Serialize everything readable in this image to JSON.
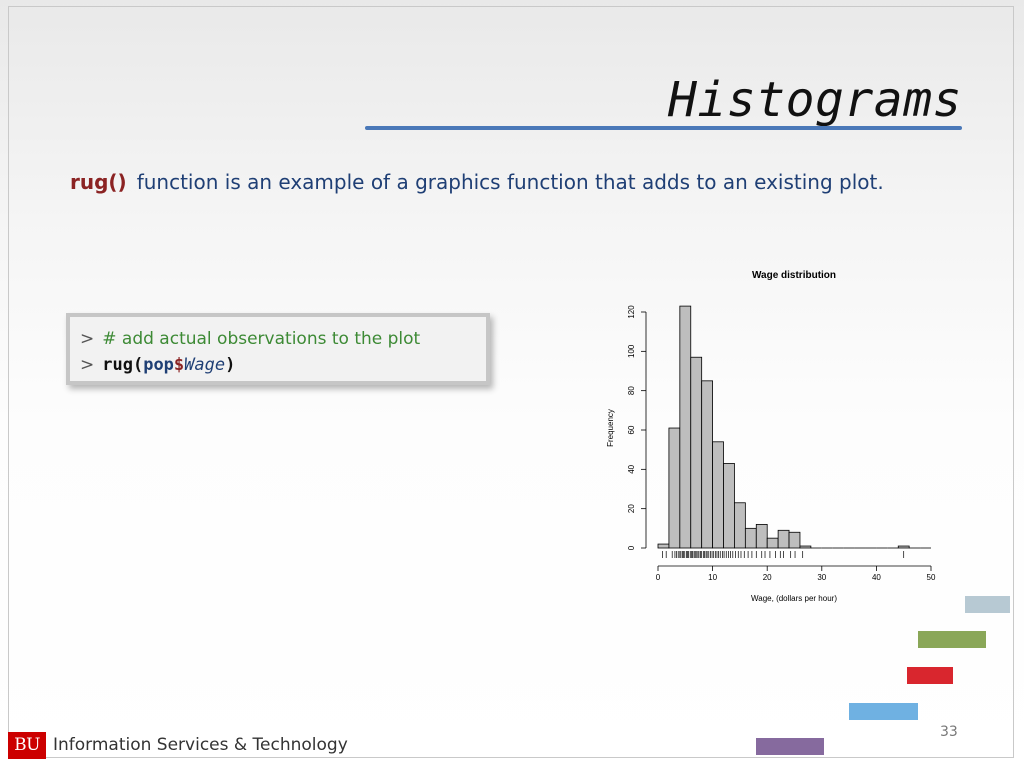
{
  "slide": {
    "title": "Histograms",
    "intro_fn": "rug()",
    "intro_text": "function is an example  of a graphics function that adds to an existing plot.",
    "code": {
      "line1_prompt": ">",
      "line1_comment": "# add actual observations to the plot",
      "line2_prompt": ">",
      "line2_fn": "rug(",
      "line2_obj": "pop",
      "line2_dollar": "$",
      "line2_var": "Wage",
      "line2_close": ")"
    },
    "page_number": "33"
  },
  "footer": {
    "logo_text": "BU",
    "org_name": "Information Services & Technology"
  },
  "colors": {
    "title_rule": "#4a78b8",
    "bar_fill": "#bebebe",
    "deco_bars": [
      "#b7c9d3",
      "#8aa758",
      "#d9262e",
      "#6fb1e2",
      "#866a9e"
    ]
  },
  "chart_data": {
    "type": "bar",
    "title": "Wage distribution",
    "xlabel": "Wage, (dollars per hour)",
    "ylabel": "Frequency",
    "xlim": [
      0,
      50
    ],
    "ylim": [
      0,
      120
    ],
    "xticks": [
      0,
      10,
      20,
      30,
      40,
      50
    ],
    "yticks": [
      0,
      20,
      40,
      60,
      80,
      100,
      120
    ],
    "bin_width": 2,
    "bins": [
      {
        "x0": 0,
        "x1": 2,
        "count": 2
      },
      {
        "x0": 2,
        "x1": 4,
        "count": 61
      },
      {
        "x0": 4,
        "x1": 6,
        "count": 123
      },
      {
        "x0": 6,
        "x1": 8,
        "count": 97
      },
      {
        "x0": 8,
        "x1": 10,
        "count": 85
      },
      {
        "x0": 10,
        "x1": 12,
        "count": 54
      },
      {
        "x0": 12,
        "x1": 14,
        "count": 43
      },
      {
        "x0": 14,
        "x1": 16,
        "count": 23
      },
      {
        "x0": 16,
        "x1": 18,
        "count": 10
      },
      {
        "x0": 18,
        "x1": 20,
        "count": 12
      },
      {
        "x0": 20,
        "x1": 22,
        "count": 5
      },
      {
        "x0": 22,
        "x1": 24,
        "count": 9
      },
      {
        "x0": 24,
        "x1": 26,
        "count": 8
      },
      {
        "x0": 26,
        "x1": 28,
        "count": 1
      },
      {
        "x0": 28,
        "x1": 30,
        "count": 0
      },
      {
        "x0": 30,
        "x1": 32,
        "count": 0
      },
      {
        "x0": 32,
        "x1": 34,
        "count": 0
      },
      {
        "x0": 34,
        "x1": 36,
        "count": 0
      },
      {
        "x0": 36,
        "x1": 38,
        "count": 0
      },
      {
        "x0": 38,
        "x1": 40,
        "count": 0
      },
      {
        "x0": 40,
        "x1": 42,
        "count": 0
      },
      {
        "x0": 42,
        "x1": 44,
        "count": 0
      },
      {
        "x0": 44,
        "x1": 46,
        "count": 1
      },
      {
        "x0": 46,
        "x1": 48,
        "count": 0
      },
      {
        "x0": 48,
        "x1": 50,
        "count": 0
      }
    ],
    "rug": [
      0.8,
      1.5,
      2.6,
      3.1,
      3.4,
      3.7,
      4.0,
      4.2,
      4.5,
      4.7,
      4.9,
      5.2,
      5.4,
      5.6,
      5.9,
      6.1,
      6.3,
      6.6,
      6.8,
      7.0,
      7.3,
      7.5,
      7.8,
      8.0,
      8.3,
      8.5,
      8.8,
      9.0,
      9.3,
      9.6,
      9.9,
      10.2,
      10.5,
      10.8,
      11.1,
      11.4,
      11.8,
      12.1,
      12.5,
      12.9,
      13.3,
      13.7,
      14.2,
      14.7,
      15.2,
      15.8,
      16.5,
      17.2,
      18.0,
      19.0,
      19.6,
      20.5,
      21.5,
      22.4,
      23.0,
      24.3,
      25.1,
      26.5,
      45.0
    ]
  }
}
